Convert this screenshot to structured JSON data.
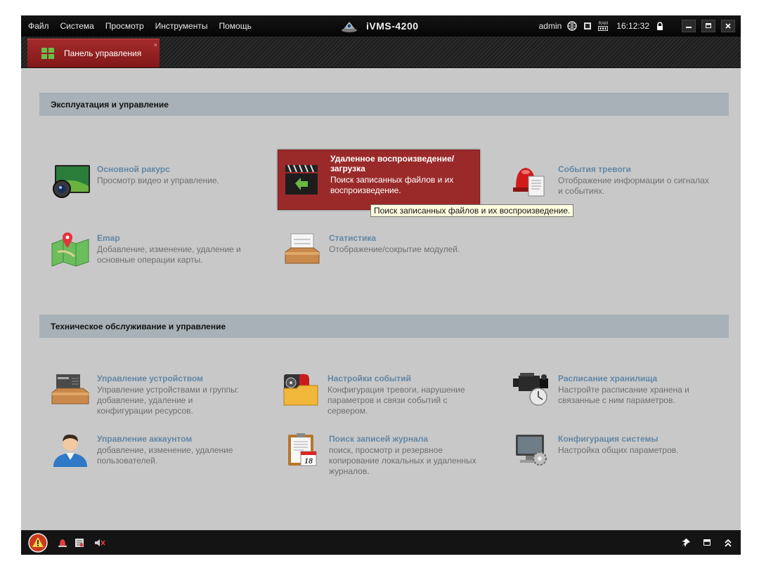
{
  "menu": [
    "Файл",
    "Система",
    "Просмотр",
    "Инструменты",
    "Помощь"
  ],
  "app_title": "iVMS-4200",
  "status": {
    "user": "admin",
    "time": "16:12:32",
    "ram_label": "RAM"
  },
  "tab": {
    "label": "Панель управления",
    "close": "×"
  },
  "sections": {
    "operation": "Эксплуатация и управление",
    "maintenance": "Техническое обслуживание и управление"
  },
  "modules": {
    "main_view": {
      "title": "Основной ракурс",
      "desc": "Просмотр видео и управление."
    },
    "remote_playback": {
      "title": "Удаленное воспроизведение/ загрузка",
      "desc": "Поиск записанных файлов и их воспроизведение."
    },
    "alarm_events": {
      "title": "События тревоги",
      "desc": "Отображение информации о сигналах и событиях."
    },
    "emap": {
      "title": "Emap",
      "desc": "Добавление, изменение, удаление и основные операции карты."
    },
    "statistics": {
      "title": "Статистика",
      "desc": "Отображение/сокрытие модулей."
    },
    "device_mgmt": {
      "title": "Управление устройством",
      "desc": "Управление устройствами и группы: добавление, удаление и конфигурации ресурсов."
    },
    "event_settings": {
      "title": "Настройки событий",
      "desc": "Конфигурация тревоги, нарушение параметров и связи событий с сервером."
    },
    "storage_schedule": {
      "title": "Расписание хранилища",
      "desc": "Настройте расписание хранена и связанные с ним параметров."
    },
    "account_mgmt": {
      "title": "Управление аккаунтом",
      "desc": "добавление, изменение, удаление пользователей."
    },
    "log_search": {
      "title": "Поиск записей журнала",
      "desc": "поиск, просмотр и резервное копирование локальных и удаленных журналов."
    },
    "system_config": {
      "title": "Конфигурация системы",
      "desc": "Настройка общих параметров."
    }
  },
  "calendar_day": "18",
  "tooltip": "Поиск записанных файлов и их воспроизведение.",
  "colors": {
    "accent_red": "#9a2a2a",
    "link_blue": "#6287a5",
    "section_bg": "#a7b1b7"
  }
}
